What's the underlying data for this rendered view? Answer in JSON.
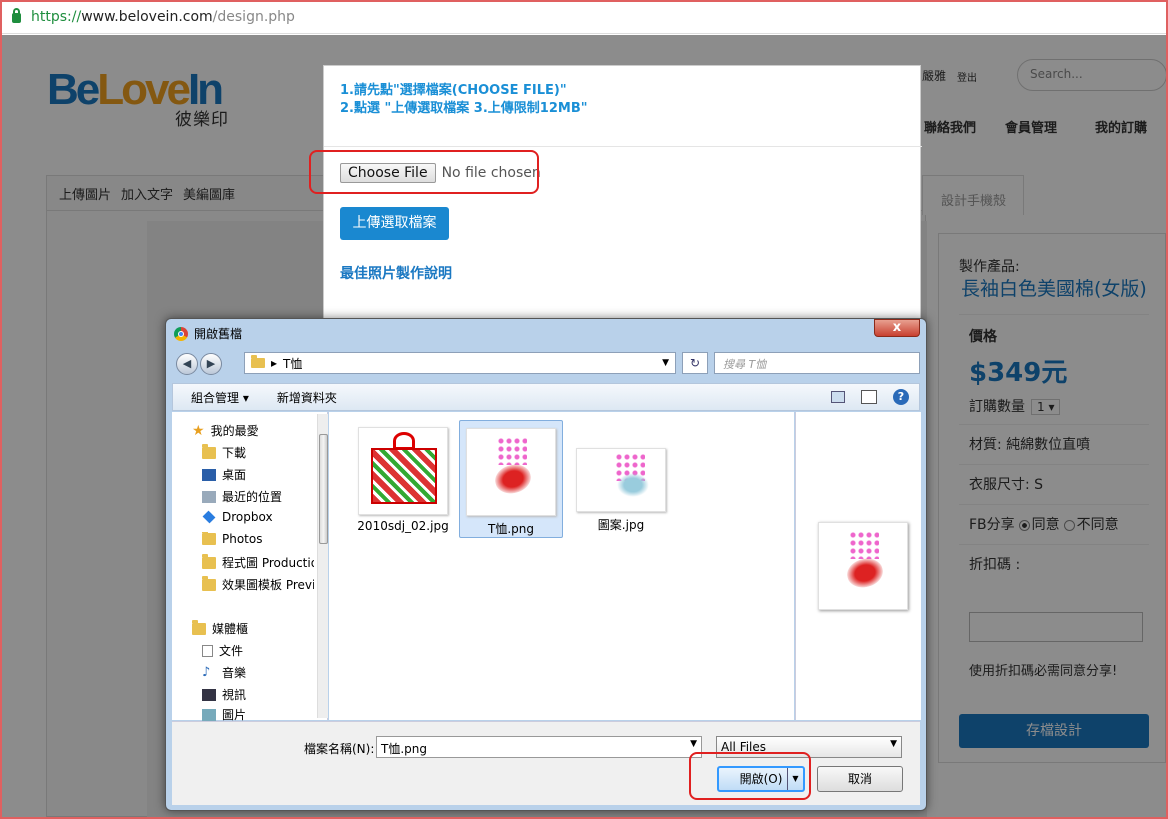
{
  "browser": {
    "url_proto": "https://",
    "url_host": "www.belovein.com",
    "url_path": "/design.php"
  },
  "site": {
    "logo_be": "Be",
    "logo_love": "Love",
    "logo_in": "In",
    "logo_sub": "彼樂印",
    "top_links": [
      "嚴雅",
      "登出"
    ],
    "search_placeholder": "Search...",
    "nav": [
      "聯絡我們",
      "會員管理",
      "我的訂購"
    ],
    "tabs_left": [
      "上傳圖片",
      "加入文字",
      "美編圖庫"
    ],
    "tab_right": "設計手機殼"
  },
  "panel": {
    "product_label": "製作產品:",
    "product_name": "長袖白色美國棉(女版)",
    "price_label": "價格",
    "price": "$349元",
    "qty_label": "訂購數量",
    "qty_value": "1",
    "material": "材質: 純綿數位直噴",
    "size": "衣服尺寸: S",
    "fb_label": "FB分享",
    "fb_yes": "同意",
    "fb_no": "不同意",
    "discount_label": "折扣碼 :",
    "discount_note": "使用折扣碼必需同意分享!",
    "save_label": "存檔設計"
  },
  "modal": {
    "instructions": "1.請先點\"選擇檔案(CHOOSE FILE)\"\n2.點選 \"上傳選取檔案 3.上傳限制12MB\"",
    "choose_file": "Choose File",
    "no_file": "No file chosen",
    "upload_label": "上傳選取檔案",
    "best_photo": "最佳照片製作說明"
  },
  "dialog": {
    "title": "開啟舊檔",
    "path_folder": "T恤",
    "search_placeholder": "搜尋 T恤",
    "toolbar": [
      "組合管理",
      "新增資料夾"
    ],
    "nav_items": [
      "我的最愛",
      "下載",
      "桌面",
      "最近的位置",
      "Dropbox",
      "Photos",
      "程式圖 Production",
      "效果圖模板 Preview",
      "媒體櫃",
      "文件",
      "音樂",
      "視訊",
      "圖片"
    ],
    "files": [
      {
        "name": "2010sdj_02.jpg",
        "selected": false
      },
      {
        "name": "T恤.png",
        "selected": true
      },
      {
        "name": "圖案.jpg",
        "selected": false
      }
    ],
    "filename_label": "檔案名稱(N):",
    "filename_value": "T恤.png",
    "filetype_value": "All Files",
    "open_label": "開啟(O)",
    "cancel_label": "取消",
    "close_label": "x"
  }
}
